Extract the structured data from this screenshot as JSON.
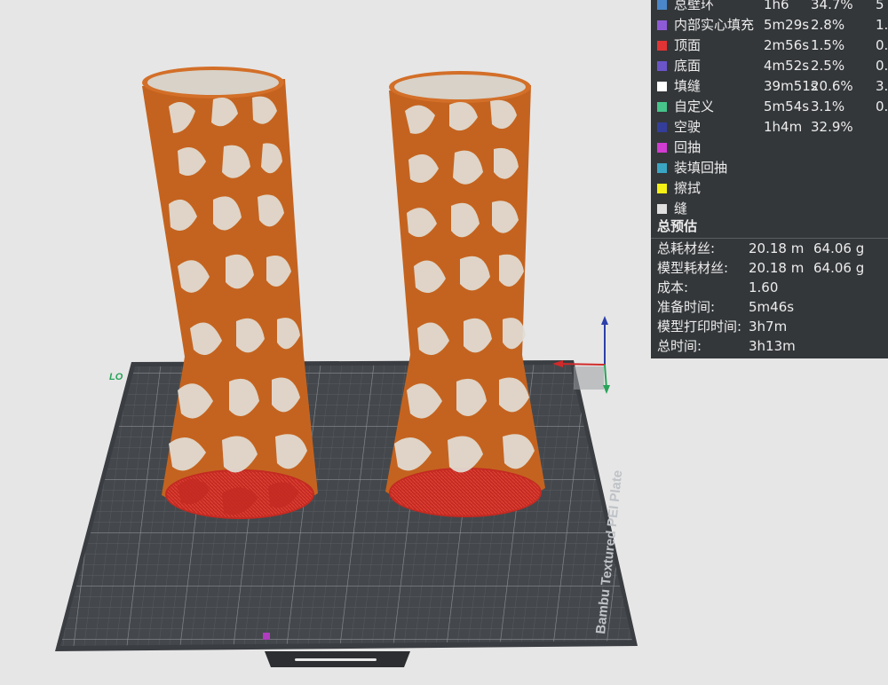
{
  "viewport": {
    "bed_label": "Bambu Textured PEI Plate",
    "axis_hint": "LO"
  },
  "legend": {
    "rows": [
      {
        "label": "总壁环",
        "time": "1h6",
        "percent": "34.7%",
        "weight": "5",
        "color": "#4a86c9"
      },
      {
        "label": "内部实心填充",
        "time": "5m29s",
        "percent": "2.8%",
        "weight": "1.",
        "color": "#8e5bd6"
      },
      {
        "label": "顶面",
        "time": "2m56s",
        "percent": "1.5%",
        "weight": "0.",
        "color": "#e23434"
      },
      {
        "label": "底面",
        "time": "4m52s",
        "percent": "2.5%",
        "weight": "0.",
        "color": "#6b55c9"
      },
      {
        "label": "填缝",
        "time": "39m51s",
        "percent": "20.6%",
        "weight": "3.",
        "color": "#ffffff"
      },
      {
        "label": "自定义",
        "time": "5m54s",
        "percent": "3.1%",
        "weight": "0.",
        "color": "#47c48a"
      },
      {
        "label": "空驶",
        "time": "1h4m",
        "percent": "32.9%",
        "weight": "",
        "color": "#343e9a"
      },
      {
        "label": "回抽",
        "time": "",
        "percent": "",
        "weight": "",
        "color": "#d13cd1"
      },
      {
        "label": "装填回抽",
        "time": "",
        "percent": "",
        "weight": "",
        "color": "#3aa6c4"
      },
      {
        "label": "擦拭",
        "time": "",
        "percent": "",
        "weight": "",
        "color": "#f5f016"
      },
      {
        "label": "缝",
        "time": "",
        "percent": "",
        "weight": "",
        "color": "#e0e0e0"
      }
    ]
  },
  "summary": {
    "title": "总预估",
    "rows": [
      {
        "key": "总耗材丝:",
        "v1": "20.18 m",
        "v2": "64.06 g"
      },
      {
        "key": "模型耗材丝:",
        "v1": "20.18 m",
        "v2": "64.06 g"
      },
      {
        "key": "成本:",
        "v1": "1.60",
        "v2": ""
      },
      {
        "key": "准备时间:",
        "v1": "5m46s",
        "v2": ""
      },
      {
        "key": "模型打印时间:",
        "v1": "3h7m",
        "v2": ""
      },
      {
        "key": "总时间:",
        "v1": "3h13m",
        "v2": ""
      }
    ]
  },
  "colors": {
    "model": "#c4631f",
    "bed": "#404448",
    "panel_bg": "#34373a",
    "background": "#e6e6e6"
  }
}
